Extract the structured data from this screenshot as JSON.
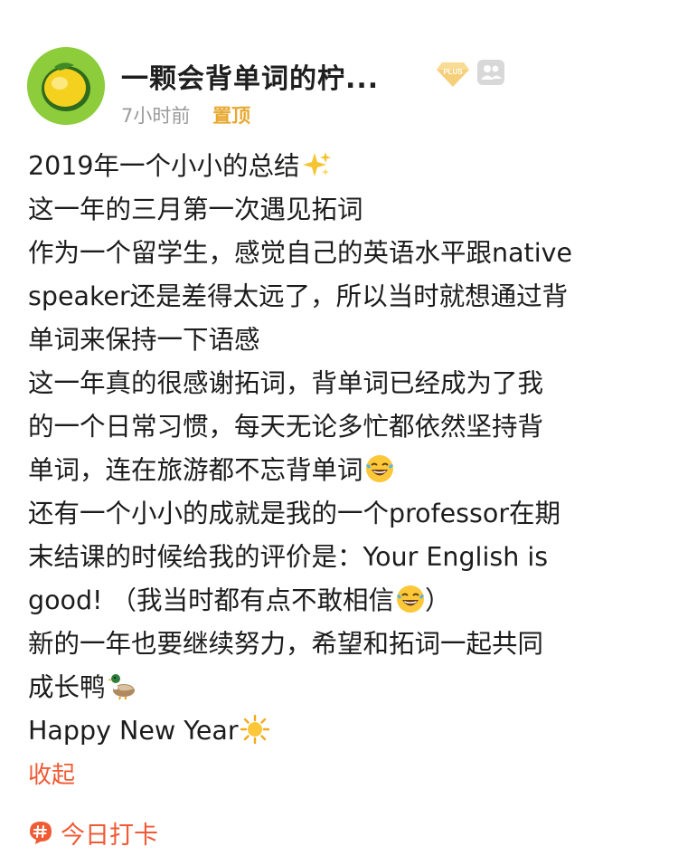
{
  "post": {
    "author": {
      "name": "一颗会背单词的柠...",
      "avatar_icon": "lemon-avatar",
      "badge_text": "PLUS",
      "badge_icon": "plus-diamond-icon",
      "friend_icon": "friends-icon"
    },
    "meta": {
      "time": "7小时前",
      "pinned": "置顶"
    },
    "lines": [
      "2019年一个小小的总结",
      "这一年的三月第一次遇见拓词",
      "作为一个留学生，感觉自己的英语水平跟native",
      "speaker还是差得太远了，所以当时就想通过背",
      "单词来保持一下语感",
      "这一年真的很感谢拓词，背单词已经成为了我",
      "的一个日常习惯，每天无论多忙都依然坚持背",
      "单词，连在旅游都不忘背单词",
      "还有一个小小的成就是我的一个professor在期",
      "末结课的时候给我的评价是：Your English is",
      "good! （我当时都有点不敢相信",
      "新的一年也要继续努力，希望和拓词一起共同",
      "成长鸭",
      "Happy New Year"
    ],
    "line_tail": {
      "line_10_close": "）"
    },
    "emojis": {
      "sparkles": "sparkles-icon",
      "laughing": "laughing-tears-icon",
      "duck": "duck-icon",
      "sun": "sun-icon"
    },
    "collapse_label": "收起",
    "tag": {
      "label": "今日打卡",
      "icon": "hashtag-icon"
    }
  },
  "colors": {
    "accent": "#f05a35",
    "pin": "#e7a931",
    "avatar_bg": "#8dcd3b",
    "meta_gray": "#9a9a9a"
  }
}
